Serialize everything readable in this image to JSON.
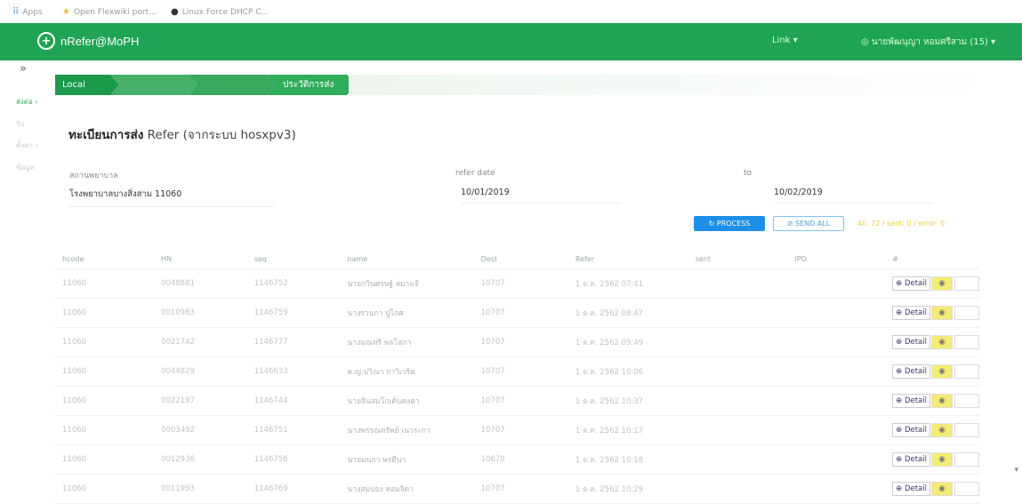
{
  "bookmarks": [
    {
      "icon": "apps-icon",
      "label": "Apps"
    },
    {
      "icon": "bookmark-icon",
      "label": "Open Flexwiki port..."
    },
    {
      "icon": "linux-icon",
      "label": "Linux Force DHCP C..."
    }
  ],
  "app": {
    "title": "nRefer@MoPH",
    "link_menu": "Link",
    "user_menu": "นายพัฒนุญา หอมศรีสาม (15)"
  },
  "sidebar": {
    "toggle": "»",
    "items": [
      "ส่งต่อ",
      "รับ",
      "ตั้งค่า",
      "ข้อมูล"
    ]
  },
  "breadcrumb": [
    "Local",
    "",
    "",
    "ประวัติการส่ง"
  ],
  "page": {
    "title_bold": "ทะเบียนการส่ง",
    "title_en": "Refer (จากระบบ hosxpv3)"
  },
  "filters": {
    "hospital_label": "สถานพยาบาล",
    "hospital_value": "โรงพยาบาลบางสิ่งสาม 11060",
    "refer_date_label": "refer date",
    "refer_date_value": "10/01/2019",
    "to_label": "to",
    "to_value": "10/02/2019"
  },
  "actions": {
    "process_label": "↻ PROCESS",
    "send_all_label": "⊘ SEND ALL",
    "stats": "All: 72 / sent: 0 / error: 0"
  },
  "table": {
    "headers": [
      "hcode",
      "HN",
      "seq",
      "name",
      "Dest",
      "Refer",
      "sent",
      "IPD",
      "#"
    ],
    "detail_label": "Detail",
    "rows": [
      {
        "hcode": "11060",
        "hn": "0048881",
        "seq": "1146752",
        "name": "นายกวินศรษฐ์ สมาแจ้",
        "dest": "10707",
        "refer": "1 ต.ค. 2562 07:41",
        "sent": "",
        "ipd": ""
      },
      {
        "hcode": "11060",
        "hn": "0010983",
        "seq": "1146759",
        "name": "นางรวนกา ปูโกศ",
        "dest": "10707",
        "refer": "1 ต.ค. 2562 08:47",
        "sent": "",
        "ipd": ""
      },
      {
        "hcode": "11060",
        "hn": "0021742",
        "seq": "1146777",
        "name": "นางมณทรี พลโสภา",
        "dest": "10707",
        "refer": "1 ต.ค. 2562 09:49",
        "sent": "",
        "ipd": ""
      },
      {
        "hcode": "11060",
        "hn": "0044829",
        "seq": "1146633",
        "name": "ด.ญ.ปวิณา กาวิเวริต",
        "dest": "10707",
        "refer": "1 ต.ค. 2562 10:06",
        "sent": "",
        "ipd": ""
      },
      {
        "hcode": "11060",
        "hn": "0022197",
        "seq": "1146744",
        "name": "นายจินสมโกเด้นคงดา",
        "dest": "10707",
        "refer": "1 ต.ค. 2562 10:37",
        "sent": "",
        "ipd": ""
      },
      {
        "hcode": "11060",
        "hn": "0003492",
        "seq": "1146751",
        "name": "นางพรรณทรัพย์ เนาระกา",
        "dest": "10707",
        "refer": "1 ต.ค. 2562 10:17",
        "sent": "",
        "ipd": ""
      },
      {
        "hcode": "11060",
        "hn": "0012936",
        "seq": "1146756",
        "name": "นายมนกา พรดีนา",
        "dest": "10670",
        "refer": "1 ต.ค. 2562 10:18",
        "sent": "",
        "ipd": ""
      },
      {
        "hcode": "11060",
        "hn": "0011993",
        "seq": "1146769",
        "name": "นางสมปอง หอมจิดา",
        "dest": "10707",
        "refer": "1 ต.ค. 2562 10:29",
        "sent": "",
        "ipd": ""
      }
    ]
  },
  "colors": {
    "header_bg": "#1fa354",
    "breadcrumb": [
      "#1b9a4c",
      "#47b06a",
      "#3aa960",
      "#2fae5a"
    ],
    "process_btn": "#1e8fe8",
    "eye_btn": "#f4ec74"
  }
}
